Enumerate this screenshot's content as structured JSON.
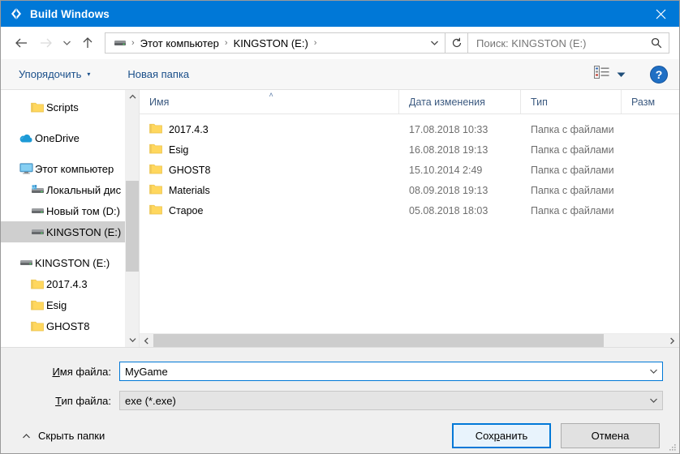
{
  "window": {
    "title": "Build Windows",
    "icon": "unity-logo-icon",
    "close_label": "✕"
  },
  "nav": {
    "back_icon": "arrow-left-icon",
    "forward_icon": "arrow-right-icon",
    "recent_icon": "chevron-down-icon",
    "up_icon": "arrow-up-icon",
    "refresh_icon": "refresh-icon",
    "breadcrumb_dropdown_icon": "chevron-down-icon",
    "breadcrumb": [
      {
        "label": "",
        "icon": "drive-icon"
      },
      {
        "label": "Этот компьютер",
        "icon": ""
      },
      {
        "label": "KINGSTON (E:)",
        "icon": ""
      }
    ],
    "separator": "›"
  },
  "search": {
    "placeholder": "Поиск: KINGSTON (E:)",
    "value": "",
    "icon": "search-icon"
  },
  "toolbar": {
    "organize_label": "Упорядочить",
    "organize_caret": "▾",
    "new_folder_label": "Новая папка",
    "view_icon": "view-options-icon",
    "view_caret": "▾",
    "help_label": "?",
    "help_icon": "help-icon"
  },
  "sidebar": {
    "items": [
      {
        "label": "Scripts",
        "icon": "folder-icon",
        "indent": 2,
        "selected": false
      },
      {
        "label": "OneDrive",
        "icon": "onedrive-icon",
        "indent": 1,
        "selected": false,
        "gap_before": true
      },
      {
        "label": "Этот компьютер",
        "icon": "computer-icon",
        "indent": 1,
        "selected": false,
        "gap_before": true
      },
      {
        "label": "Локальный дис",
        "icon": "local-disk-icon",
        "indent": 2,
        "selected": false
      },
      {
        "label": "Новый том (D:)",
        "icon": "drive-icon",
        "indent": 2,
        "selected": false
      },
      {
        "label": "KINGSTON (E:)",
        "icon": "drive-icon",
        "indent": 2,
        "selected": true
      },
      {
        "label": "KINGSTON (E:)",
        "icon": "drive-icon",
        "indent": 1,
        "selected": false,
        "gap_before": true
      },
      {
        "label": "2017.4.3",
        "icon": "folder-icon",
        "indent": 2,
        "selected": false
      },
      {
        "label": "Esig",
        "icon": "folder-icon",
        "indent": 2,
        "selected": false
      },
      {
        "label": "GHOST8",
        "icon": "folder-icon",
        "indent": 2,
        "selected": false
      }
    ],
    "scroll_up_icon": "chevron-up-icon",
    "scroll_down_icon": "chevron-down-icon"
  },
  "filelist": {
    "columns": [
      {
        "key": "name",
        "label": "Имя",
        "sorted": true,
        "sort_caret": "˄"
      },
      {
        "key": "date",
        "label": "Дата изменения",
        "sorted": false
      },
      {
        "key": "type",
        "label": "Тип",
        "sorted": false
      },
      {
        "key": "size",
        "label": "Разм",
        "sorted": false
      }
    ],
    "rows": [
      {
        "name": "2017.4.3",
        "date": "17.08.2018 10:33",
        "type": "Папка с файлами",
        "size": "",
        "icon": "folder-icon"
      },
      {
        "name": "Esig",
        "date": "16.08.2018 19:13",
        "type": "Папка с файлами",
        "size": "",
        "icon": "folder-icon"
      },
      {
        "name": "GHOST8",
        "date": "15.10.2014 2:49",
        "type": "Папка с файлами",
        "size": "",
        "icon": "folder-icon"
      },
      {
        "name": "Materials",
        "date": "08.09.2018 19:13",
        "type": "Папка с файлами",
        "size": "",
        "icon": "folder-icon"
      },
      {
        "name": "Старое",
        "date": "05.08.2018 18:03",
        "type": "Папка с файлами",
        "size": "",
        "icon": "folder-icon"
      }
    ],
    "hscroll_left_icon": "chevron-left-icon",
    "hscroll_right_icon": "chevron-right-icon"
  },
  "form": {
    "filename_label_prefix": "И",
    "filename_label_rest": "мя файла:",
    "filename_value": "MyGame",
    "filename_placeholder": "",
    "filetype_label_prefix": "Т",
    "filetype_label_rest": "ип файла:",
    "filetype_value": "exe (*.exe)",
    "dropdown_icon": "chevron-down-icon"
  },
  "footer": {
    "hide_folders_label": "Скрыть папки",
    "hide_folders_icon": "chevron-up-icon",
    "save_prefix": "Сох",
    "save_accel": "р",
    "save_suffix": "анить",
    "cancel_label": "Отмена",
    "resize_grip_icon": "resize-grip-icon"
  },
  "colors": {
    "titlebar": "#0078d7",
    "accent": "#0078d7",
    "toolbar_link": "#1a4f8a",
    "selection": "#cfcfcf",
    "folder": "#ffd75e",
    "muted_text": "#6e6e6e"
  }
}
